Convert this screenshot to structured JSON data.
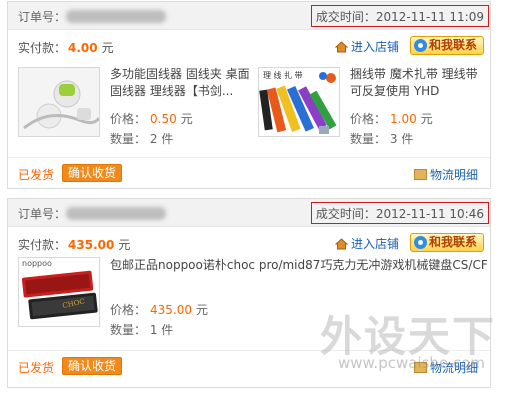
{
  "orders": [
    {
      "order_label": "订单号：",
      "deal_time": "成交时间：2012-11-11 11:09",
      "paid_label": "实付款：",
      "paid_amount": "4.00",
      "currency": "元",
      "store_label": "进入店铺",
      "contact_label": "和我联系",
      "items": [
        {
          "name": "多功能固线器 固线夹 桌面固线器 理线器【书剑...",
          "price_label": "价格：",
          "price": "0.50",
          "currency": "元",
          "qty": "数量： 2 件"
        },
        {
          "name": "捆线带 魔术扎带 理线带 可反复使用 YHD",
          "thumb_caption": "理 线 扎 带",
          "price_label": "价格：",
          "price": "1.00",
          "currency": "元",
          "qty": "数量： 3 件"
        }
      ],
      "status": "已发货",
      "confirm_label": "确认收货",
      "logistics_label": "物流明细"
    },
    {
      "order_label": "订单号：",
      "deal_time": "成交时间：2012-11-11 10:46",
      "paid_label": "实付款：",
      "paid_amount": "435.00",
      "currency": "元",
      "store_label": "进入店铺",
      "contact_label": "和我联系",
      "items": [
        {
          "name": "包邮正品noppoo诺朴choc pro/mid87巧克力无冲游戏机械键盘CS/CF",
          "thumb_caption": "noppoo",
          "price_label": "价格：",
          "price": "435.00",
          "currency": "元",
          "qty": "数量： 1 件"
        }
      ],
      "status": "已发货",
      "confirm_label": "确认收货",
      "logistics_label": "物流明细"
    }
  ],
  "watermark": {
    "text": "外设天下",
    "url": "www.pcwaishe.com"
  },
  "colors": {
    "accent_orange": "#ff6600",
    "link_blue": "#1a5fb4",
    "highlight_red": "#d21a1a"
  }
}
